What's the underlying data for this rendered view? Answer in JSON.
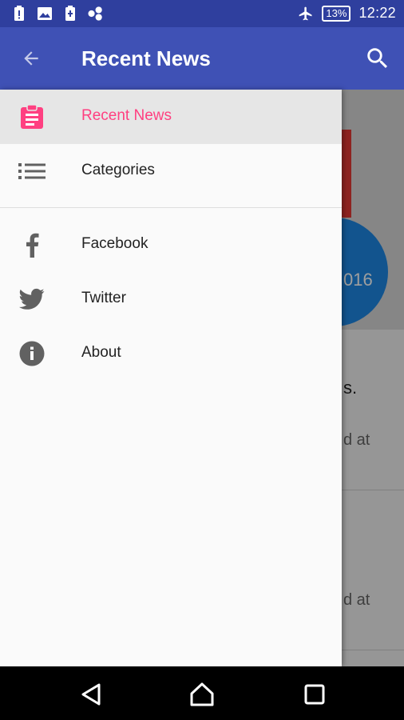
{
  "status_bar": {
    "battery_percent": "13%",
    "time": "12:22",
    "icons": [
      "alert-battery-icon",
      "image-icon",
      "battery-charging-icon",
      "share-network-icon",
      "airplane-icon"
    ]
  },
  "toolbar": {
    "title": "Recent News",
    "back_icon": "arrow-back-icon",
    "search_icon": "search-icon",
    "color": "#3f51b5"
  },
  "drawer": {
    "items": [
      {
        "label": "Recent News",
        "icon": "clipboard-icon",
        "active": true
      },
      {
        "label": "Categories",
        "icon": "list-icon",
        "active": false
      },
      {
        "label": "Facebook",
        "icon": "facebook-icon",
        "active": false
      },
      {
        "label": "Twitter",
        "icon": "twitter-icon",
        "active": false
      },
      {
        "label": "About",
        "icon": "info-icon",
        "active": false
      }
    ],
    "accent_color": "#ff4081"
  },
  "background_content": {
    "year_fragment": "016",
    "headline_fragment": "s.",
    "meta_fragment_1": "d at",
    "meta_fragment_2": "d at"
  },
  "navigation_bar": {
    "icons": [
      "back-triangle-icon",
      "home-icon",
      "recents-square-icon"
    ]
  }
}
